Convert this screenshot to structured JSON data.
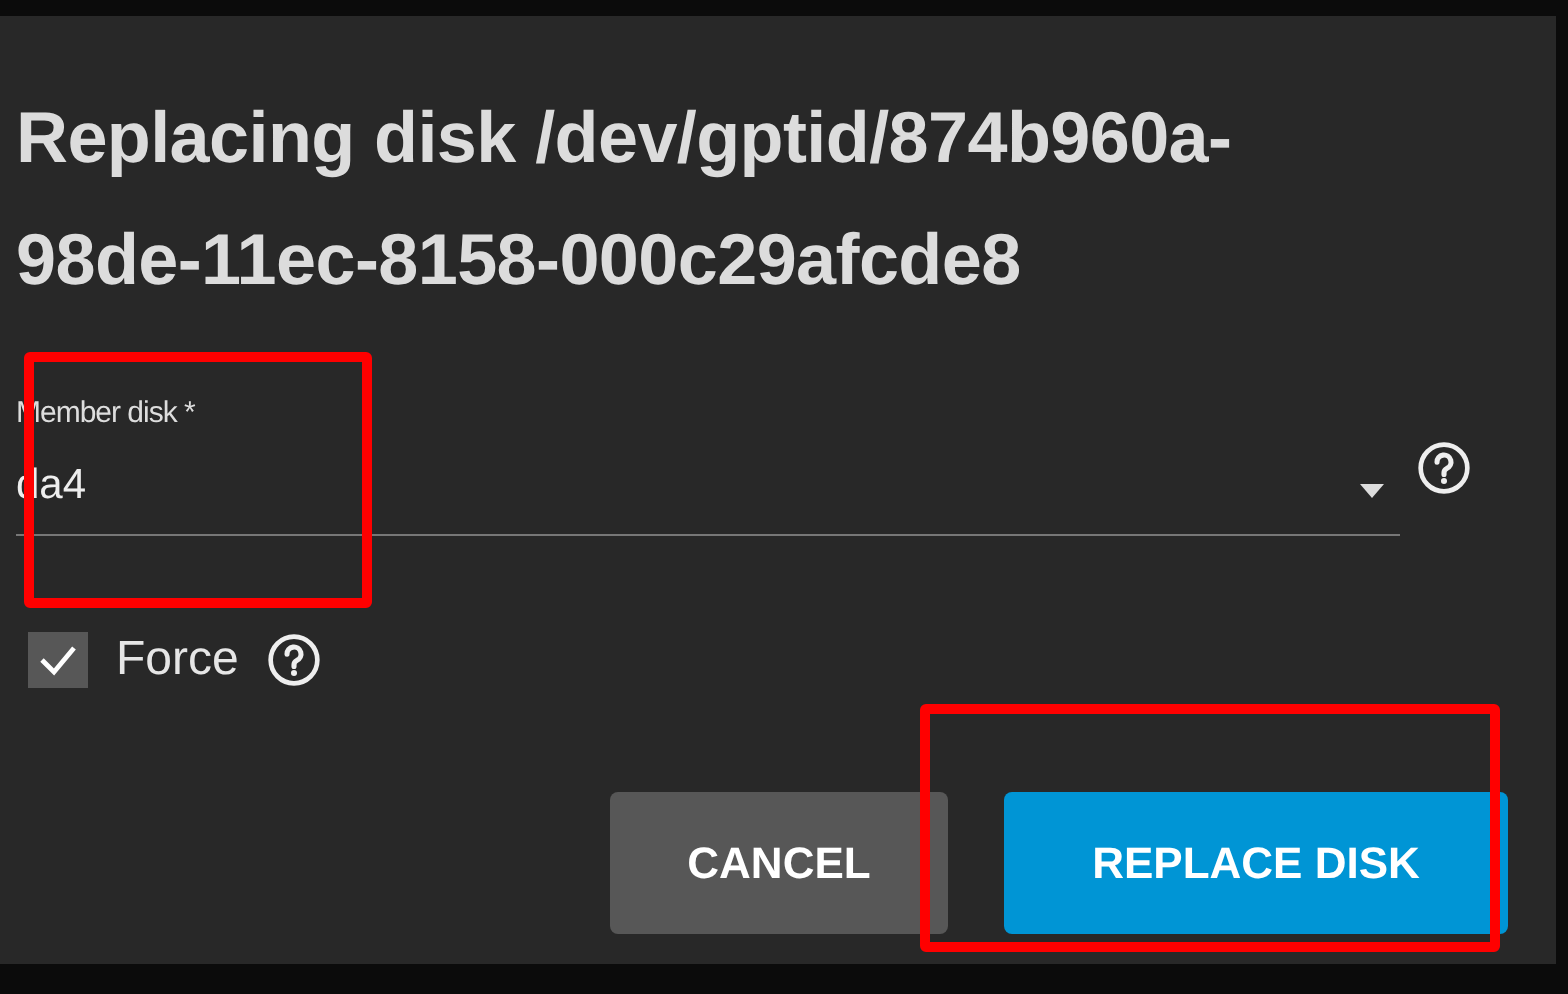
{
  "dialog": {
    "title": "Replacing disk /dev/gptid/874b960a-98de-11ec-8158-000c29afcde8",
    "member_disk": {
      "label": "Member disk *",
      "value": "da4",
      "highlighted": true
    },
    "force": {
      "label": "Force",
      "checked": true
    },
    "buttons": [
      {
        "label": "CANCEL",
        "kind": "secondary",
        "highlighted": false
      },
      {
        "label": "REPLACE DISK",
        "kind": "primary",
        "highlighted": true
      }
    ]
  }
}
